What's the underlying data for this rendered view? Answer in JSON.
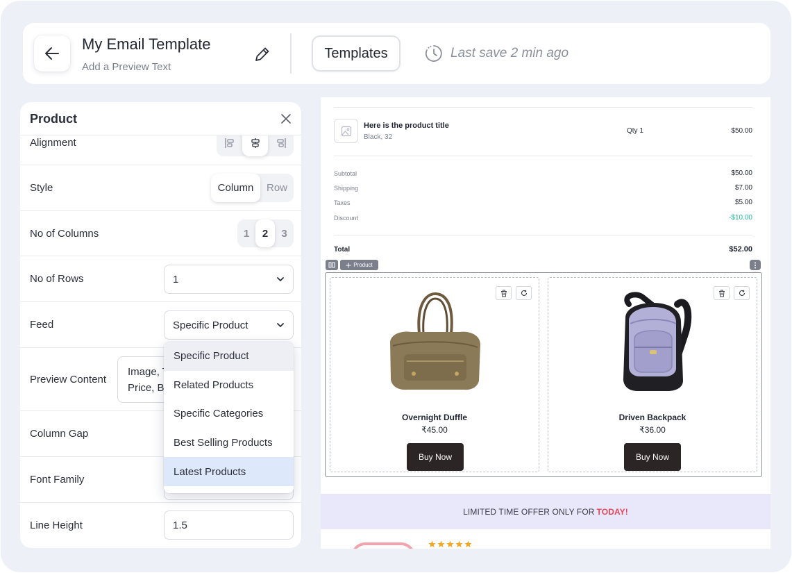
{
  "header": {
    "title": "My Email Template",
    "subtitle": "Add a Preview Text",
    "templates_label": "Templates",
    "last_save": "Last save 2 min ago"
  },
  "panel": {
    "title": "Product",
    "alignment_label": "Alignment",
    "style_label": "Style",
    "style_options": [
      "Column",
      "Row"
    ],
    "style_selected": "Column",
    "columns_label": "No of Columns",
    "columns_options": [
      "1",
      "2",
      "3"
    ],
    "columns_selected": "2",
    "rows_label": "No of Rows",
    "rows_value": "1",
    "feed_label": "Feed",
    "feed_value": "Specific Product",
    "feed_options": [
      "Specific Product",
      "Related Products",
      "Specific Categories",
      "Best Selling Products",
      "Latest Products"
    ],
    "preview_content_label": "Preview Content",
    "preview_content_value_line1": "Image, T",
    "preview_content_value_line2": "Price, Bu",
    "column_gap_label": "Column Gap",
    "font_family_label": "Font Family",
    "line_height_label": "Line Height",
    "line_height_value": "1.5"
  },
  "preview": {
    "order_item": {
      "title": "Here is the product title",
      "variant": "Black, 32",
      "qty": "Qty 1",
      "price": "$50.00"
    },
    "summary": [
      {
        "label": "Subtotal",
        "value": "$50.00"
      },
      {
        "label": "Shipping",
        "value": "$7.00"
      },
      {
        "label": "Taxes",
        "value": "$5.00"
      },
      {
        "label": "Discount",
        "value": "-$10.00"
      }
    ],
    "total_label": "Total",
    "total_value": "$52.00",
    "block_chip": "Product",
    "products": [
      {
        "name": "Overnight Duffle",
        "price": "₹45.00",
        "button": "Buy Now"
      },
      {
        "name": "Driven Backpack",
        "price": "₹36.00",
        "button": "Buy Now"
      }
    ],
    "offer_text": "LIMITED TIME OFFER ONLY FOR",
    "offer_highlight": "TODAY!"
  },
  "colors": {
    "background": "#eef0f8",
    "discount": "#1fb59a",
    "offer_bg": "#e8e8fa",
    "offer_highlight": "#e8455a",
    "buy_button": "#2b2526",
    "dropdown_hover": "#dde9fb"
  },
  "icons": [
    "back-arrow-icon",
    "pencil-icon",
    "clock-icon",
    "close-icon",
    "align-left-icon",
    "align-center-icon",
    "align-right-icon",
    "chevron-down-icon",
    "image-placeholder-icon",
    "columns-icon",
    "move-icon",
    "more-vertical-icon",
    "trash-icon",
    "refresh-icon",
    "star-icon"
  ]
}
